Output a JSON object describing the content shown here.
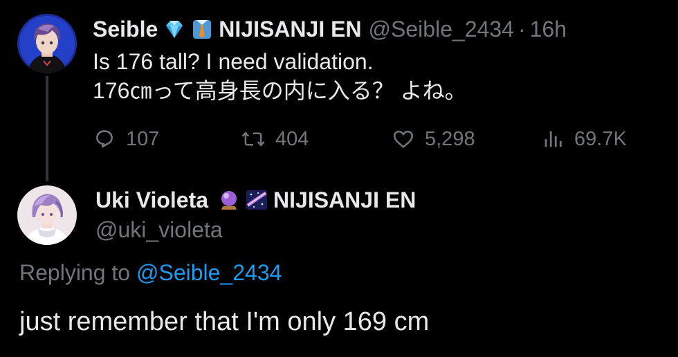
{
  "colors": {
    "background": "#000000",
    "primary_text": "#e7e9ea",
    "secondary_text": "#71767b",
    "link": "#1d9bf0",
    "thread_line": "#333639"
  },
  "tweet1": {
    "author_name": "Seible",
    "badges": [
      "gem-icon",
      "necktie-icon"
    ],
    "affiliation": "NIJISANJI EN",
    "handle": "@Seible_2434",
    "separator": "·",
    "time": "16h",
    "text_lines": [
      "Is 176 tall? I need validation.",
      "176㎝って高身長の内に入る？ よね。"
    ],
    "actions": {
      "replies": "107",
      "reposts": "404",
      "likes": "5,298",
      "views": "69.7K"
    }
  },
  "tweet2": {
    "author_name": "Uki Violeta",
    "badges": [
      "crystal-ball-icon",
      "milky-way-icon"
    ],
    "affiliation": "NIJISANJI EN",
    "handle": "@uki_violeta",
    "replying_prefix": "Replying to",
    "replying_to": "@Seible_2434",
    "text": "just remember that I'm only 169 cm"
  }
}
